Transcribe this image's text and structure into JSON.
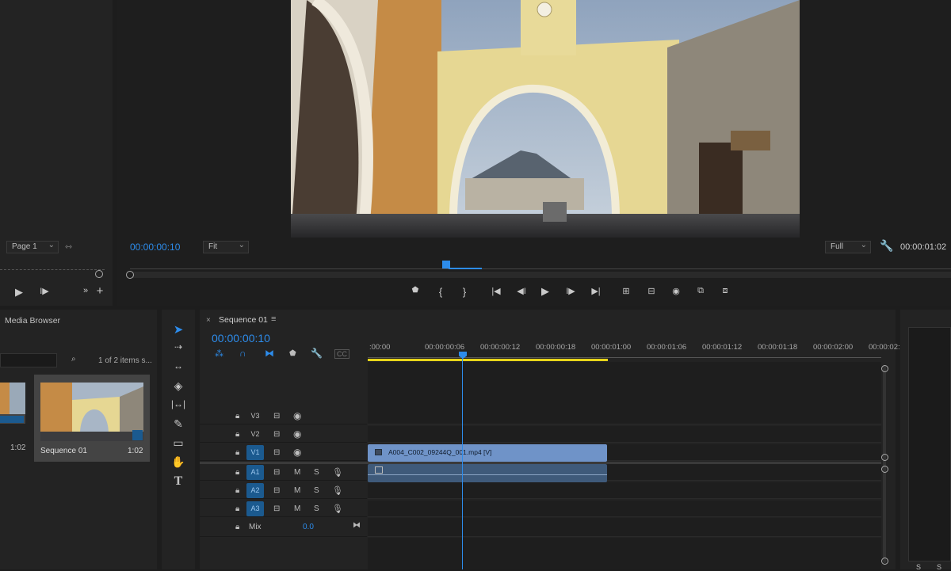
{
  "source_monitor": {
    "page_label": "Page 1"
  },
  "program_monitor": {
    "timecode_current": "00:00:00:10",
    "zoom_select": "Fit",
    "resolution_select": "Full",
    "timecode_duration": "00:00:01:02"
  },
  "project_panel": {
    "tab_label": "Media Browser",
    "item_count": "1 of 2 items s...",
    "items": [
      {
        "name": "",
        "duration": "1:02"
      },
      {
        "name": "Sequence 01",
        "duration": "1:02"
      }
    ]
  },
  "timeline": {
    "sequence_tab": "Sequence 01",
    "close_glyph": "×",
    "menu_glyph": "≡",
    "timecode": "00:00:00:10",
    "ruler_labels": [
      ":00:00",
      "00:00:00:06",
      "00:00:00:12",
      "00:00:00:18",
      "00:00:01:00",
      "00:00:01:06",
      "00:00:01:12",
      "00:00:01:18",
      "00:00:02:00",
      "00:00:02:"
    ],
    "tracks_video": [
      "V3",
      "V2",
      "V1"
    ],
    "tracks_audio": [
      "A1",
      "A2",
      "A3"
    ],
    "mute_label": "M",
    "solo_label": "S",
    "mix_label": "Mix",
    "mix_value": "0.0",
    "clip_name": "A004_C002_09244Q_001.mp4 [V]"
  },
  "meters": {
    "s_labels": [
      "S",
      "S"
    ]
  },
  "colors": {
    "accent": "#2d8ceb",
    "clip_video": "#6f93c8",
    "clip_audio": "#3f5a7a",
    "work_area": "#e8d51a",
    "target_track": "#1b5a8f"
  }
}
